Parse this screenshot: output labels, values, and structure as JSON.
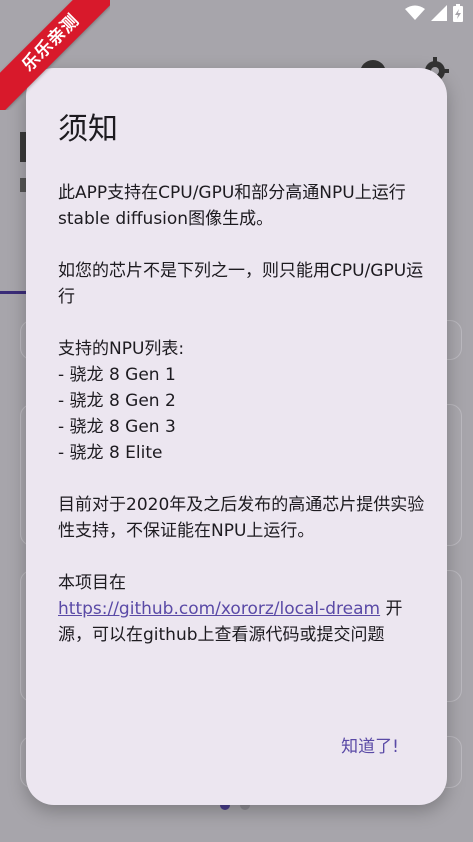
{
  "watermark": {
    "text": "乐乐亲测"
  },
  "background": {
    "icons": [
      "help-icon",
      "gear-icon"
    ]
  },
  "status_bar": {
    "icons": [
      "wifi-icon",
      "signal-icon",
      "battery-charging-icon"
    ]
  },
  "dialog": {
    "title": "须知",
    "paragraphs": {
      "p1": "此APP支持在CPU/GPU和部分高通NPU上运行stable diffusion图像生成。",
      "p2": "如您的芯片不是下列之一，则只能用CPU/GPU运行",
      "p3_heading": "支持的NPU列表:",
      "npu_list": [
        "- 骁龙 8 Gen 1",
        "- 骁龙 8 Gen 2",
        "- 骁龙 8 Gen 3",
        "- 骁龙 8 Elite"
      ],
      "p4": "目前对于2020年及之后发布的高通芯片提供实验性支持，不保证能在NPU上运行。",
      "p5_prefix": "本项目在",
      "p5_link": "https://github.com/xororz/local-dream",
      "p5_suffix": " 开源，可以在github上查看源代码或提交问题"
    },
    "confirm_label": "知道了!"
  },
  "colors": {
    "scrim": "#a7a5ab",
    "dialog_bg": "#ece6f0",
    "accent": "#5a4aa6",
    "watermark_red": "#d8192b"
  }
}
